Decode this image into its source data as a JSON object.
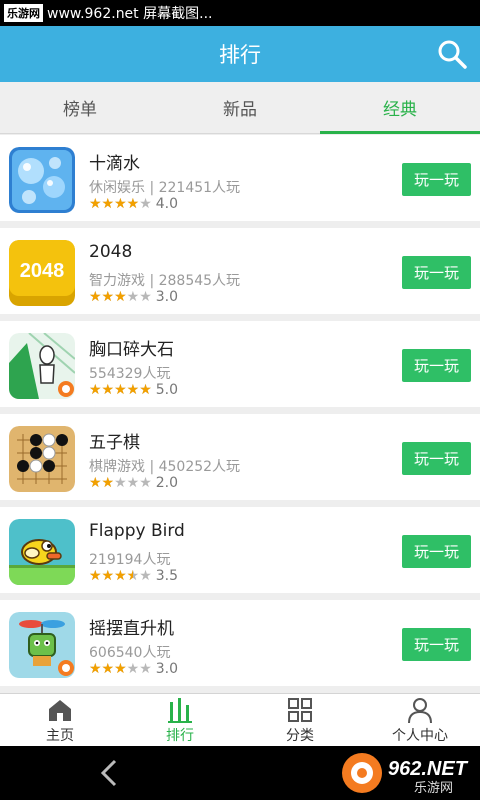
{
  "status_bar": {
    "watermark_badge": "乐游网",
    "text": "www.962.net 屏幕截图..."
  },
  "app_bar": {
    "title": "排行",
    "search_icon": "search-icon"
  },
  "tabs": [
    {
      "label": "榜单",
      "active": false
    },
    {
      "label": "新品",
      "active": false
    },
    {
      "label": "经典",
      "active": true
    }
  ],
  "games": [
    {
      "name": "十滴水",
      "meta": "休闲娱乐 | 221451人玩",
      "rating": 4.0,
      "rating_text": "4.0",
      "button": "玩一玩",
      "icon": "water-drops-icon"
    },
    {
      "name": "2048",
      "meta": "智力游戏 | 288545人玩",
      "rating": 3.0,
      "rating_text": "3.0",
      "button": "玩一玩",
      "icon": "2048-icon",
      "icon_text": "2048"
    },
    {
      "name": "胸口碎大石",
      "meta": "554329人玩",
      "rating": 5.0,
      "rating_text": "5.0",
      "button": "玩一玩",
      "icon": "stick-figure-icon"
    },
    {
      "name": "五子棋",
      "meta": "棋牌游戏 | 450252人玩",
      "rating": 2.0,
      "rating_text": "2.0",
      "button": "玩一玩",
      "icon": "gomoku-board-icon"
    },
    {
      "name": "Flappy Bird",
      "meta": "219194人玩",
      "rating": 3.5,
      "rating_text": "3.5",
      "button": "玩一玩",
      "icon": "flappy-bird-icon"
    },
    {
      "name": "摇摆直升机",
      "meta": "606540人玩",
      "rating": 3.0,
      "rating_text": "3.0",
      "button": "玩一玩",
      "icon": "swing-copter-icon"
    }
  ],
  "bottom_nav": [
    {
      "label": "主页",
      "icon": "home-icon",
      "active": false
    },
    {
      "label": "排行",
      "icon": "ranking-icon",
      "active": true
    },
    {
      "label": "分类",
      "icon": "grid-icon",
      "active": false
    },
    {
      "label": "个人中心",
      "icon": "person-icon",
      "active": false
    }
  ],
  "watermark": {
    "text": "962.NET",
    "subtext": "乐游网"
  },
  "colors": {
    "accent_blue": "#3db0e0",
    "accent_green": "#29b24a",
    "button_green": "#2fbf66",
    "star": "#f2a000"
  }
}
